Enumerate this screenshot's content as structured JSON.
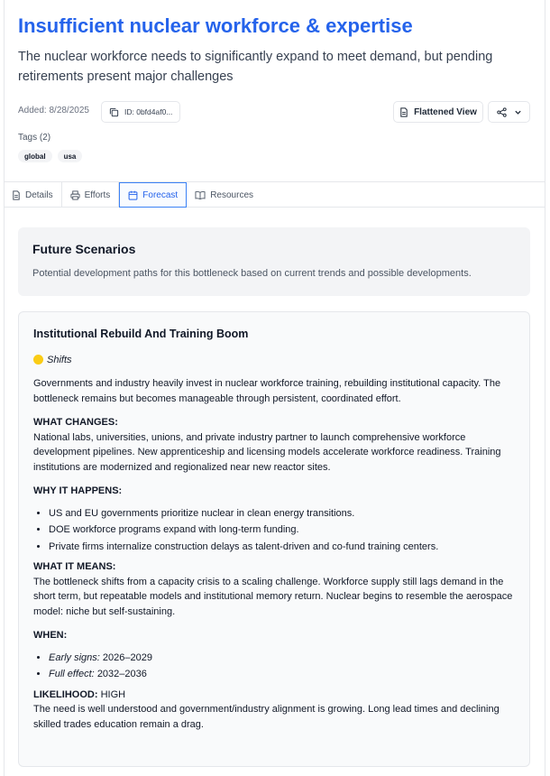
{
  "header": {
    "title": "Insufficient nuclear workforce & expertise",
    "subtitle": "The nuclear workforce needs to significantly expand to meet demand, but pending retirements present major challenges",
    "added": "Added: 8/28/2025",
    "id_label": "ID: 0bfd4af0...",
    "flattened_view_label": "Flattened View"
  },
  "tags": {
    "label": "Tags (2)",
    "items": [
      "global",
      "usa"
    ]
  },
  "tabs": [
    {
      "label": "Details",
      "icon": "file-text-icon"
    },
    {
      "label": "Efforts",
      "icon": "printer-icon"
    },
    {
      "label": "Forecast",
      "icon": "calendar-icon",
      "active": true
    },
    {
      "label": "Resources",
      "icon": "book-icon"
    }
  ],
  "scenarios": {
    "title": "Future Scenarios",
    "description": "Potential development paths for this bottleneck based on current trends and possible developments."
  },
  "scenario": {
    "title": "Institutional Rebuild And Training Boom",
    "category": "Shifts",
    "category_color": "#facc15",
    "intro": "Governments and industry heavily invest in nuclear workforce training, rebuilding institutional capacity. The bottleneck remains but becomes manageable through persistent, coordinated effort.",
    "what_changes_head": "WHAT CHANGES:",
    "what_changes": "National labs, universities, unions, and private industry partner to launch comprehensive workforce development pipelines. New apprenticeship and licensing models accelerate workforce readiness. Training institutions are modernized and regionalized near new reactor sites.",
    "why_head": "WHY IT HAPPENS:",
    "why_items": [
      "US and EU governments prioritize nuclear in clean energy transitions.",
      "DOE workforce programs expand with long-term funding.",
      "Private firms internalize construction delays as talent-driven and co-fund training centers."
    ],
    "means_head": "WHAT IT MEANS:",
    "means": "The bottleneck shifts from a capacity crisis to a scaling challenge. Workforce supply still lags demand in the short term, but repeatable models and institutional memory return. Nuclear begins to resemble the aerospace model: niche but self-sustaining.",
    "when_head": "WHEN:",
    "when_items": [
      {
        "label": "Early signs:",
        "value": "2026–2029"
      },
      {
        "label": "Full effect:",
        "value": "2032–2036"
      }
    ],
    "likelihood_head": "LIKELIHOOD:",
    "likelihood_value": "HIGH",
    "likelihood_text": "The need is well understood and government/industry alignment is growing. Long lead times and declining skilled trades education remain a drag."
  },
  "colors": {
    "accent": "#2563eb",
    "badge_bg": "#f3f4f6"
  }
}
